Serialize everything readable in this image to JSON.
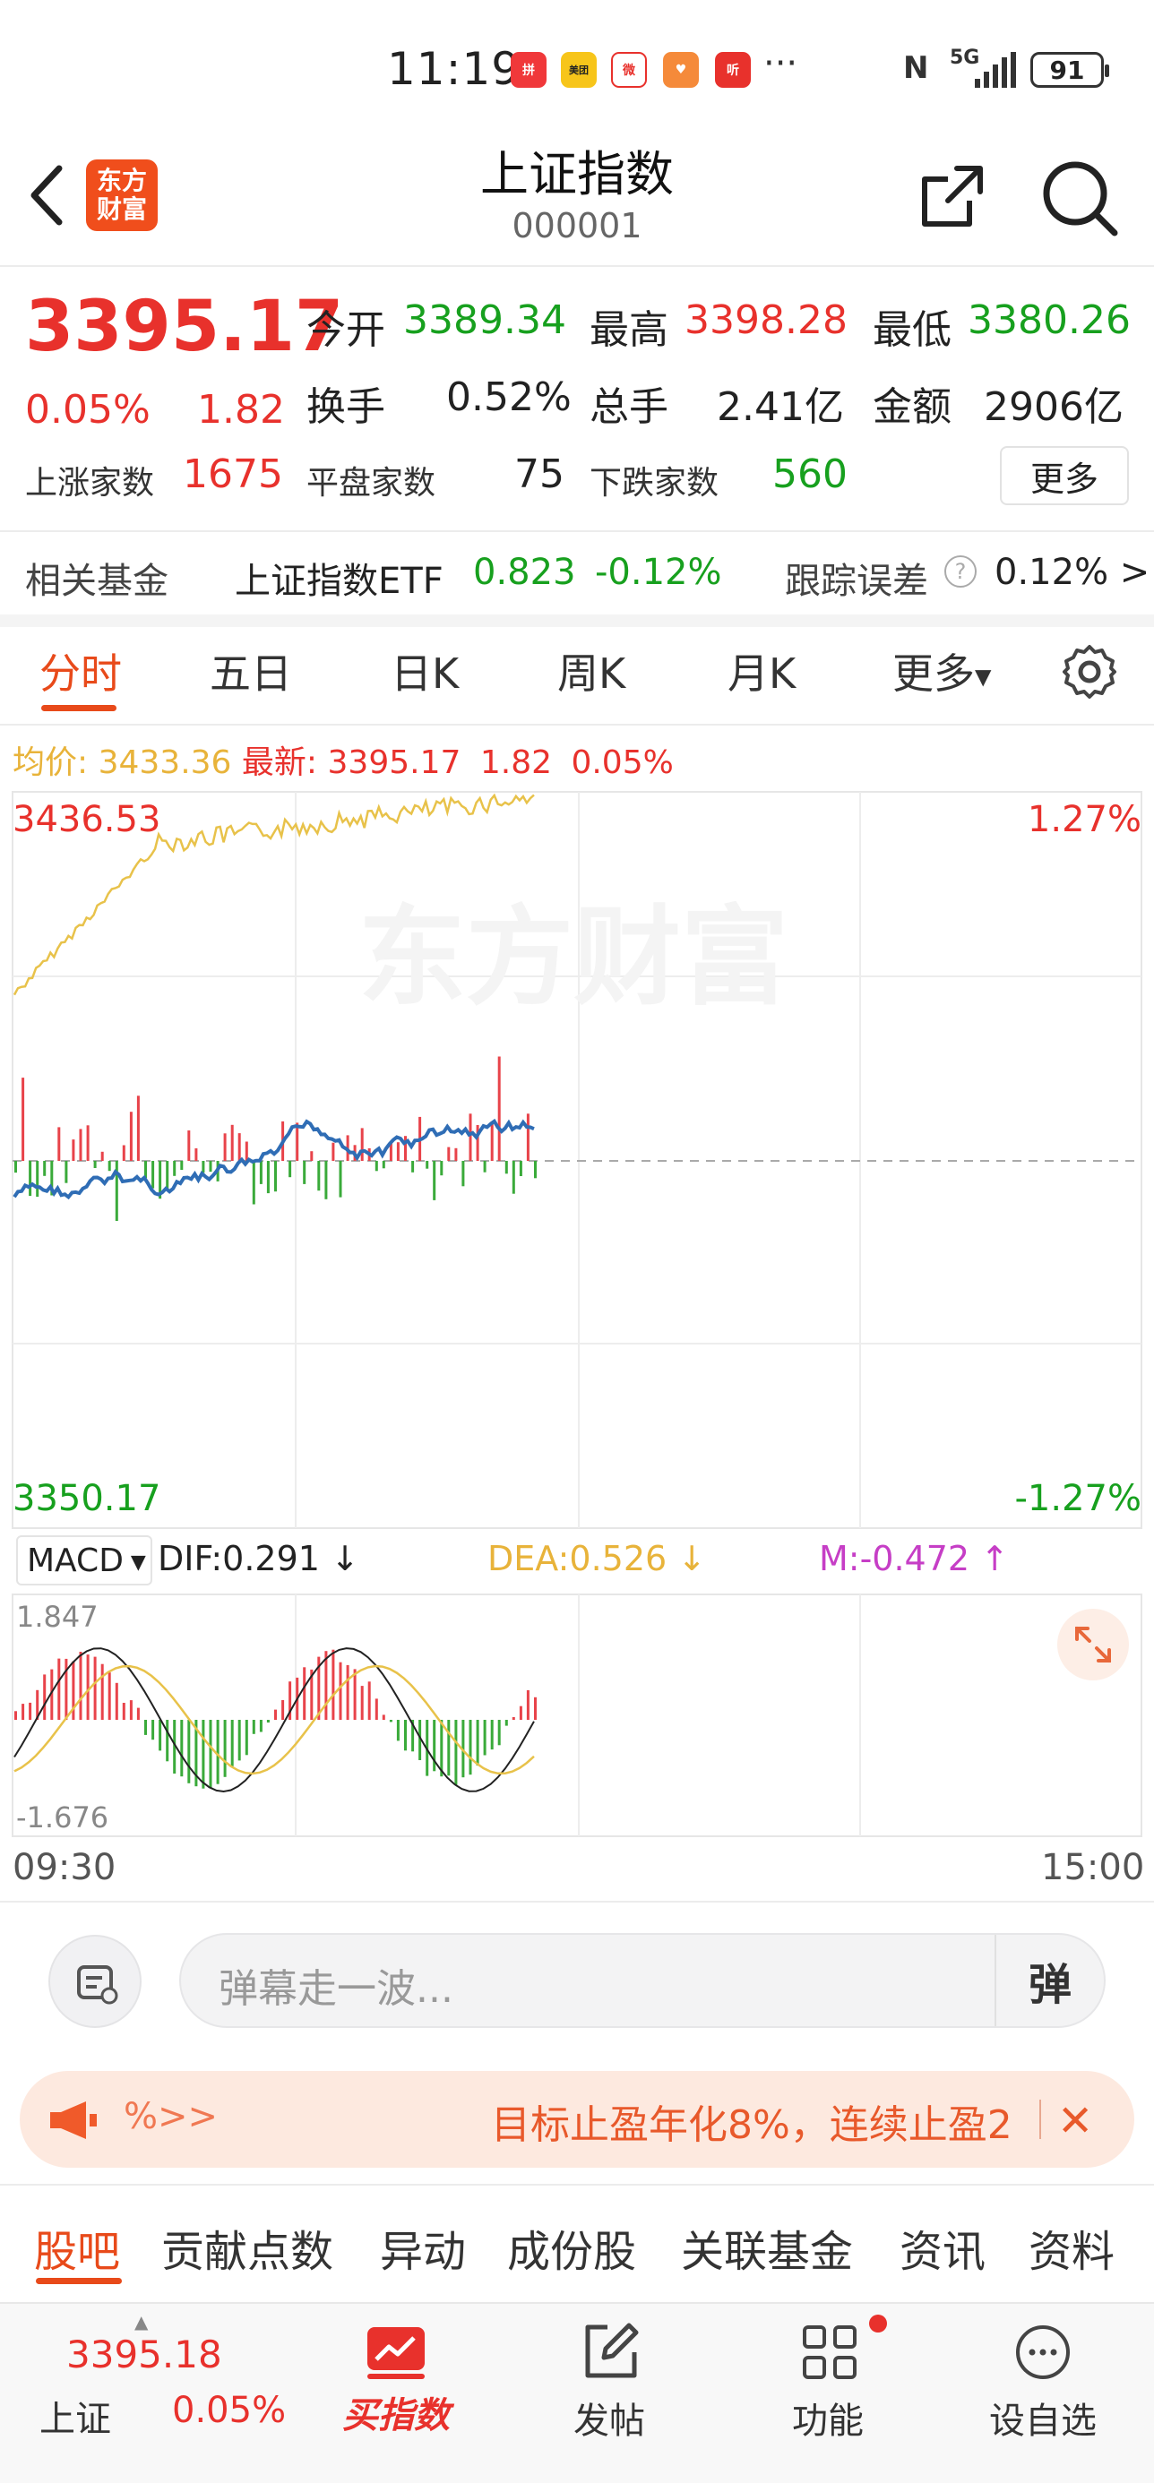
{
  "status": {
    "time": "11:19",
    "battery": "91",
    "network": "5G",
    "app_icons": [
      {
        "name": "pinduoduo-icon",
        "color": "#f0383a",
        "glyph": "拼"
      },
      {
        "name": "meituan-icon",
        "color": "#f7c51a",
        "glyph": "美团"
      },
      {
        "name": "weibo-icon",
        "color": "#e8312c",
        "glyph": "微"
      },
      {
        "name": "health-icon",
        "color": "#f58a3a",
        "glyph": "♥"
      },
      {
        "name": "listen-icon",
        "color": "#e8312c",
        "glyph": "听"
      }
    ]
  },
  "header": {
    "logo_text": "东方财富",
    "title": "上证指数",
    "code": "000001"
  },
  "quote": {
    "price": "3395.17",
    "change_pct": "0.05%",
    "change": "1.82",
    "open_label": "今开",
    "open": "3389.34",
    "high_label": "最高",
    "high": "3398.28",
    "low_label": "最低",
    "low": "3380.26",
    "turnover_label": "换手",
    "turnover": "0.52%",
    "volume_label": "总手",
    "volume": "2.41亿",
    "amount_label": "金额",
    "amount": "2906亿",
    "up_label": "上涨家数",
    "up_count": "1675",
    "flat_label": "平盘家数",
    "flat_count": "75",
    "down_label": "下跌家数",
    "down_count": "560",
    "more": "更多"
  },
  "fund": {
    "label": "相关基金",
    "name": "上证指数ETF",
    "price": "0.823",
    "change": "-0.12%",
    "track_label": "跟踪误差",
    "track_value": "0.12% >"
  },
  "tabs": [
    "分时",
    "五日",
    "日K",
    "周K",
    "月K",
    "更多"
  ],
  "chart_info": {
    "avg_label": "均价:",
    "avg_value": "3433.36",
    "latest_label": "最新:",
    "latest_value": "3395.17",
    "latest_change": "1.82",
    "latest_pct": "0.05%",
    "top_price": "3436.53",
    "top_pct": "1.27%",
    "bottom_price": "3350.17",
    "bottom_pct": "-1.27%",
    "watermark": "东方财富"
  },
  "macd": {
    "label": "MACD",
    "dif": "DIF:0.291",
    "dea": "DEA:0.526",
    "m": "M:-0.472",
    "top": "1.847",
    "bottom": "-1.676"
  },
  "time_axis": {
    "start": "09:30",
    "end": "15:00"
  },
  "danmu": {
    "placeholder": "弹幕走一波...",
    "send": "弹"
  },
  "banner": {
    "tag": "%>>",
    "text": "目标止盈年化8%，连续止盈2"
  },
  "subtabs": [
    "股吧",
    "贡献点数",
    "异动",
    "成份股",
    "关联基金",
    "资讯",
    "资料"
  ],
  "bottom_nav": {
    "price": "3395.18",
    "market": "上证",
    "pct": "0.05%",
    "buy_index": "买指数",
    "post": "发帖",
    "functions": "功能",
    "watchlist": "设自选"
  }
}
